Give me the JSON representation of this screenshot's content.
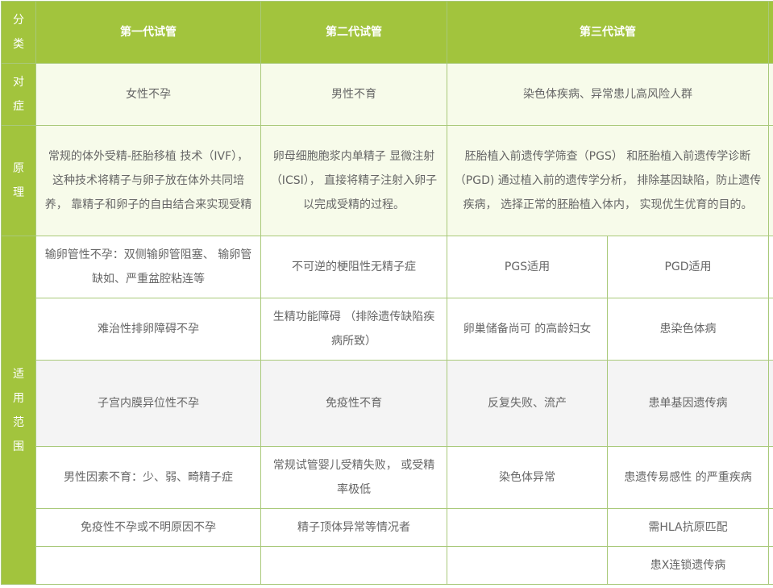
{
  "header": {
    "category": "分类",
    "gen1": "第一代试管",
    "gen2": "第二代试管",
    "gen3": "第三代试管"
  },
  "indication": {
    "label": "对症",
    "gen1": "女性不孕",
    "gen2": "男性不育",
    "gen3": "染色体疾病、异常患儿高风险人群"
  },
  "principle": {
    "label": "原理",
    "gen1": "常规的体外受精-胚胎移植 技术（IVF），这种技术将精子与卵子放在体外共同培养， 靠精子和卵子的自由结合来实现受精",
    "gen2": "卵母细胞胞浆内单精子 显微注射（ICSI）， 直接将精子注射入卵子 以完成受精的过程。",
    "gen3": "胚胎植入前遗传学筛查（PGS） 和胚胎植入前遗传学诊断（PGD) 通过植入前的遗传学分析， 排除基因缺陷，防止遗传疾病， 选择正常的胚胎植入体内， 实现优生优育的目的。"
  },
  "scope": {
    "label": "适用范围",
    "rows": [
      {
        "gen1": "输卵管性不孕：双侧输卵管阻塞、 输卵管缺如、严重盆腔粘连等",
        "gen2": "不可逆的梗阻性无精子症",
        "pgs": "PGS适用",
        "pgd": "PGD适用"
      },
      {
        "gen1": "难治性排卵障碍不孕",
        "gen2": "生精功能障碍 （排除遗传缺陷疾病所致）",
        "pgs": "卵巢储备尚可 的高龄妇女",
        "pgd": "患染色体病"
      },
      {
        "gen1": "子宫内膜异位性不孕",
        "gen2": "免疫性不育",
        "pgs": "反复失败、流产",
        "pgd": "患单基因遗传病"
      },
      {
        "gen1": "男性因素不育：少、弱、畸精子症",
        "gen2": "常规试管婴儿受精失败， 或受精率极低",
        "pgs": "染色体异常",
        "pgd": "患遗传易感性 的严重疾病"
      },
      {
        "gen1": "免疫性不孕或不明原因不孕",
        "gen2": "精子顶体异常等情况者",
        "pgs": "",
        "pgd": "需HLA抗原匹配"
      },
      {
        "gen1": "",
        "gen2": "",
        "pgs": "",
        "pgd": "患X连锁遗传病"
      }
    ]
  }
}
